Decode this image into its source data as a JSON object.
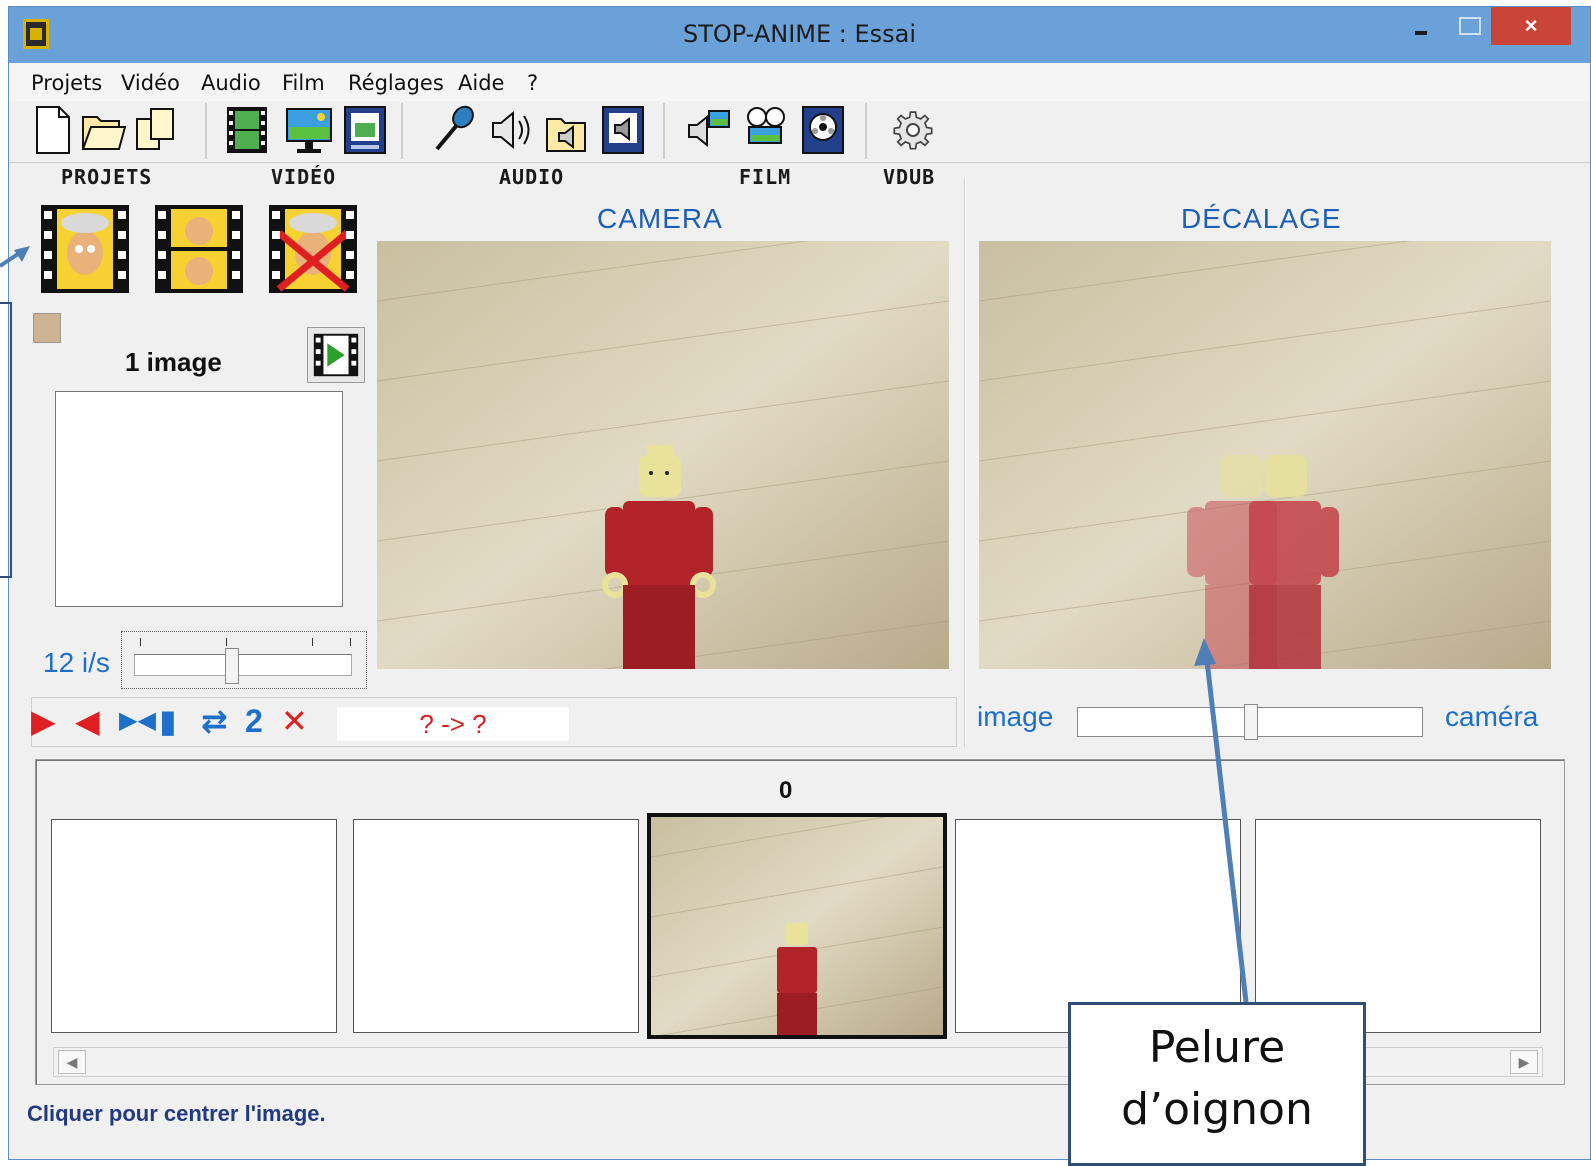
{
  "window": {
    "title": "STOP-ANIME : Essai",
    "close_label": "×"
  },
  "menu": [
    "Projets",
    "Vidéo",
    "Audio",
    "Film",
    "Réglages",
    "Aide",
    "?"
  ],
  "toolbar": {
    "groups": [
      "PROJETS",
      "VIDÉO",
      "AUDIO",
      "FILM",
      "VDUB"
    ]
  },
  "left_panel": {
    "frame_count": "1 image",
    "fps_label": "12 i/s",
    "fps_slider_level": 0.45
  },
  "camera": {
    "title": "CAMERA"
  },
  "offset": {
    "title": "DÉCALAGE",
    "left_label": "image",
    "right_label": "caméra",
    "slider_level": 0.5
  },
  "controls": {
    "copies": "2",
    "range": "? -> ?"
  },
  "timeline": {
    "current_frame": "0"
  },
  "status": "Cliquer pour centrer l'image.",
  "annotation": {
    "line1": "Pelure",
    "line2": "d’oignon"
  },
  "colors": {
    "accent": "#1d6fc9",
    "title_blue": "#1d5fb5",
    "red": "#d92020",
    "status": "#233a7e"
  }
}
